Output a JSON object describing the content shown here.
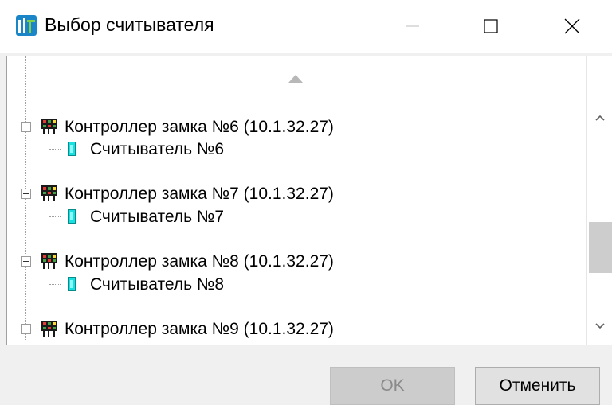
{
  "window": {
    "title": "Выбор считывателя",
    "icon": "app-logo-icon",
    "caption_buttons": [
      "minimize",
      "maximize",
      "close"
    ]
  },
  "tree": {
    "items": [
      {
        "type": "controller",
        "label": "Контроллер замка №6 (10.1.32.27)",
        "expanded": true
      },
      {
        "type": "reader",
        "label": "Считыватель №6"
      },
      {
        "type": "controller",
        "label": "Контроллер замка №7 (10.1.32.27)",
        "expanded": true
      },
      {
        "type": "reader",
        "label": "Считыватель №7"
      },
      {
        "type": "controller",
        "label": "Контроллер замка №8 (10.1.32.27)",
        "expanded": true
      },
      {
        "type": "reader",
        "label": "Считыватель №8"
      },
      {
        "type": "controller",
        "label": "Контроллер замка №9 (10.1.32.27)",
        "expanded": true
      }
    ]
  },
  "buttons": {
    "ok": "OK",
    "cancel": "Отменить"
  },
  "colors": {
    "reader_icon": "#19e0e0",
    "app_icon": "#1a86c8",
    "ok_disabled_bg": "#cccccc"
  }
}
